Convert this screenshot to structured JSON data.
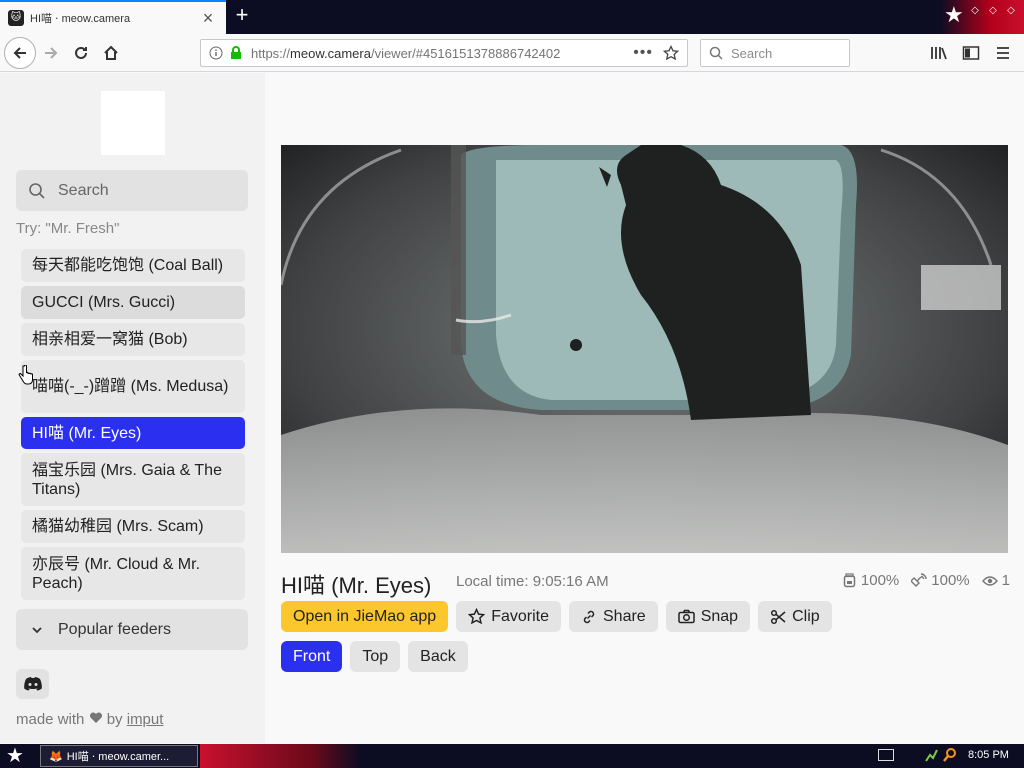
{
  "browser": {
    "tab": {
      "title": "HI喵 ‧ meow.camera"
    },
    "url": {
      "host": "meow.camera",
      "path": "/viewer/#4516151378886742402",
      "prefix": "https://"
    },
    "search_placeholder": "Search"
  },
  "sidebar": {
    "search_placeholder": "Search",
    "try_text": "Try: \"Mr. Fresh\"",
    "feeders": [
      {
        "label": "每天都能吃饱饱 (Coal Ball)"
      },
      {
        "label": "GUCCI (Mrs. Gucci)"
      },
      {
        "label": "相亲相爱一窝猫 (Bob)"
      },
      {
        "label": "喵喵(-_-)蹭蹭 (Ms. Medusa)"
      },
      {
        "label": "HI喵 (Mr. Eyes)"
      },
      {
        "label": "福宝乐园 (Mrs. Gaia & The Titans)"
      },
      {
        "label": "橘猫幼稚园 (Mrs. Scam)"
      },
      {
        "label": "亦辰号 (Mr. Cloud & Mr. Peach)"
      }
    ],
    "popular_label": "Popular feeders",
    "made_with": "made with",
    "by": "by",
    "author": "imput"
  },
  "camera": {
    "title": "HI喵 (Mr. Eyes)",
    "local_time": "Local time: 9:05:16 AM",
    "stats": {
      "food": "100%",
      "signal": "100%",
      "viewers": "1"
    },
    "buttons": {
      "open_app": "Open in JieMao app",
      "favorite": "Favorite",
      "share": "Share",
      "snap": "Snap",
      "clip": "Clip"
    },
    "views": {
      "front": "Front",
      "top": "Top",
      "back": "Back"
    }
  },
  "taskbar": {
    "window_title": "HI喵 ‧ meow.camer...",
    "clock": "8:05 PM"
  },
  "colors": {
    "accent": "#2b2ff0",
    "app_button": "#fcc72c"
  }
}
